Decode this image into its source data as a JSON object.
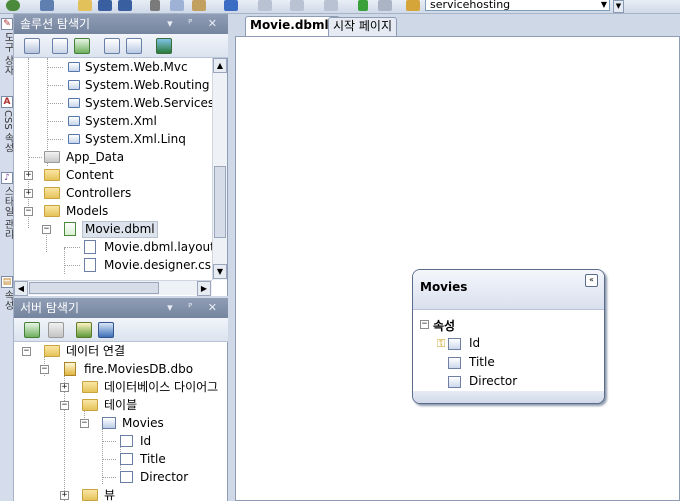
{
  "toolbar": {
    "config_combo_value": "servicehosting",
    "icons": [
      "globe-icon",
      "window-icon",
      "new-item-icon",
      "save-icon",
      "save-all-icon",
      "cut-icon",
      "copy-icon",
      "paste-icon",
      "undo-icon",
      "redo-icon",
      "nav-back-icon",
      "nav-forward-icon",
      "start-debug-icon",
      "find-icon",
      "configuration-icon"
    ]
  },
  "vertical_tabs": [
    {
      "label": "도구 상자",
      "icon": "toolbox-icon"
    },
    {
      "label": "CSS 속성",
      "icon": "css-icon"
    },
    {
      "label": "스타일 관리",
      "icon": "style-icon"
    },
    {
      "label": "속성",
      "icon": "properties-icon"
    }
  ],
  "solution_explorer": {
    "title": "솔루션 탐색기",
    "pin_glyphs": "▾ ᴾ ✕",
    "items": [
      {
        "label": "System.Web.Mvc"
      },
      {
        "label": "System.Web.Routing"
      },
      {
        "label": "System.Web.Services"
      },
      {
        "label": "System.Xml"
      },
      {
        "label": "System.Xml.Linq"
      },
      {
        "label": "App_Data"
      },
      {
        "label": "Content"
      },
      {
        "label": "Controllers"
      },
      {
        "label": "Models"
      },
      {
        "label": "Movie.dbml"
      },
      {
        "label": "Movie.dbml.layout"
      },
      {
        "label": "Movie.designer.cs"
      }
    ],
    "expanders": {
      "plus": "+",
      "minus": "−"
    }
  },
  "server_explorer": {
    "title": "서버 탐색기",
    "pin_glyphs": "▾ ᴾ ✕",
    "items": [
      {
        "label": "데이터 연결"
      },
      {
        "label": "fire.MoviesDB.dbo"
      },
      {
        "label": "데이터베이스 다이어그"
      },
      {
        "label": "테이블"
      },
      {
        "label": "Movies"
      },
      {
        "label": "Id"
      },
      {
        "label": "Title"
      },
      {
        "label": "Director"
      },
      {
        "label": "뷰"
      }
    ]
  },
  "document_tabs": [
    {
      "label": "Movie.dbml*",
      "active": true
    },
    {
      "label": "시작 페이지",
      "active": false
    }
  ],
  "entity": {
    "name": "Movies",
    "collapse_glyph": "«",
    "section_label": "속성",
    "section_toggle": "−",
    "properties": [
      {
        "name": "Id",
        "is_key": true
      },
      {
        "name": "Title",
        "is_key": false
      },
      {
        "name": "Director",
        "is_key": false
      }
    ]
  },
  "colors": {
    "panel_title": "#8091ab",
    "canvas": "#ffffff",
    "background": "#cfd8e6",
    "entity_border": "#5a6b8c"
  }
}
